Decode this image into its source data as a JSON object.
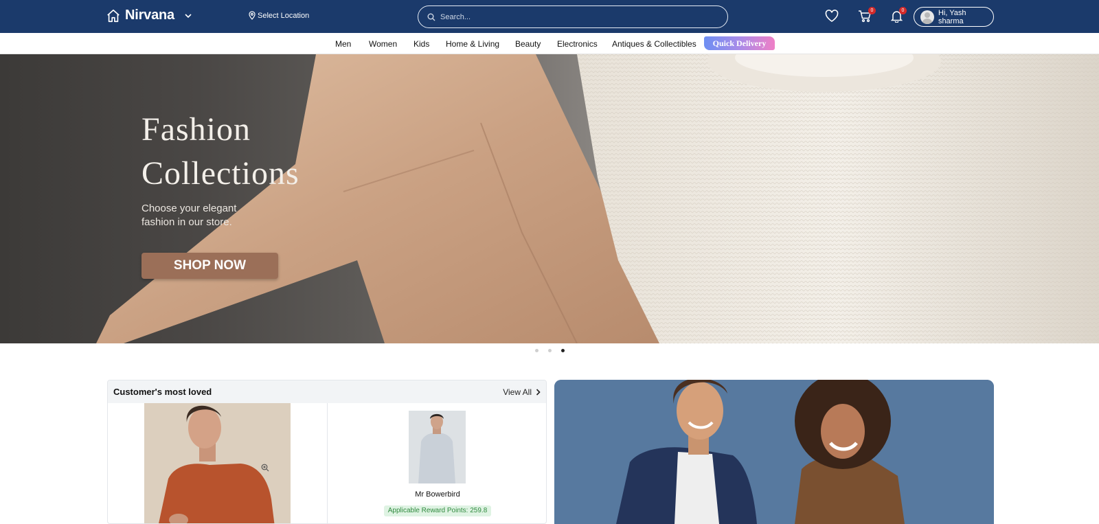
{
  "header": {
    "brand": "Nirvana",
    "location_label": "Select Location",
    "search_placeholder": "Search...",
    "wishlist_icon": "heart-icon",
    "cart_icon": "cart-icon",
    "cart_count": "0",
    "notifications_icon": "bell-icon",
    "notifications_count": "0",
    "user_greeting": "Hi, Yash sharma"
  },
  "categories": [
    "Men",
    "Women",
    "Kids",
    "Home & Living",
    "Beauty",
    "Electronics",
    "Antiques & Collectibles"
  ],
  "quick_delivery": "Quick Delivery",
  "hero": {
    "title_line1": "Fashion",
    "title_line2": "Collections",
    "subtitle_line1": "Choose your elegant",
    "subtitle_line2": "fashion in our store.",
    "cta": "SHOP NOW",
    "slide_count": 3,
    "active_slide": 3
  },
  "loved_section": {
    "title": "Customer's most loved",
    "view_all": "View All",
    "products": [
      {
        "name": "",
        "image": "man in rust t-shirt"
      },
      {
        "name": "Mr Bowerbird",
        "reward": "Applicable Reward Points: 259.8",
        "image": "man in light grey sweatshirt"
      }
    ]
  },
  "colors": {
    "header_bg": "#1b3a6b",
    "cta_bg": "#9b6f58",
    "reward_text": "#2f8a3e",
    "badge": "#d42a2a"
  }
}
